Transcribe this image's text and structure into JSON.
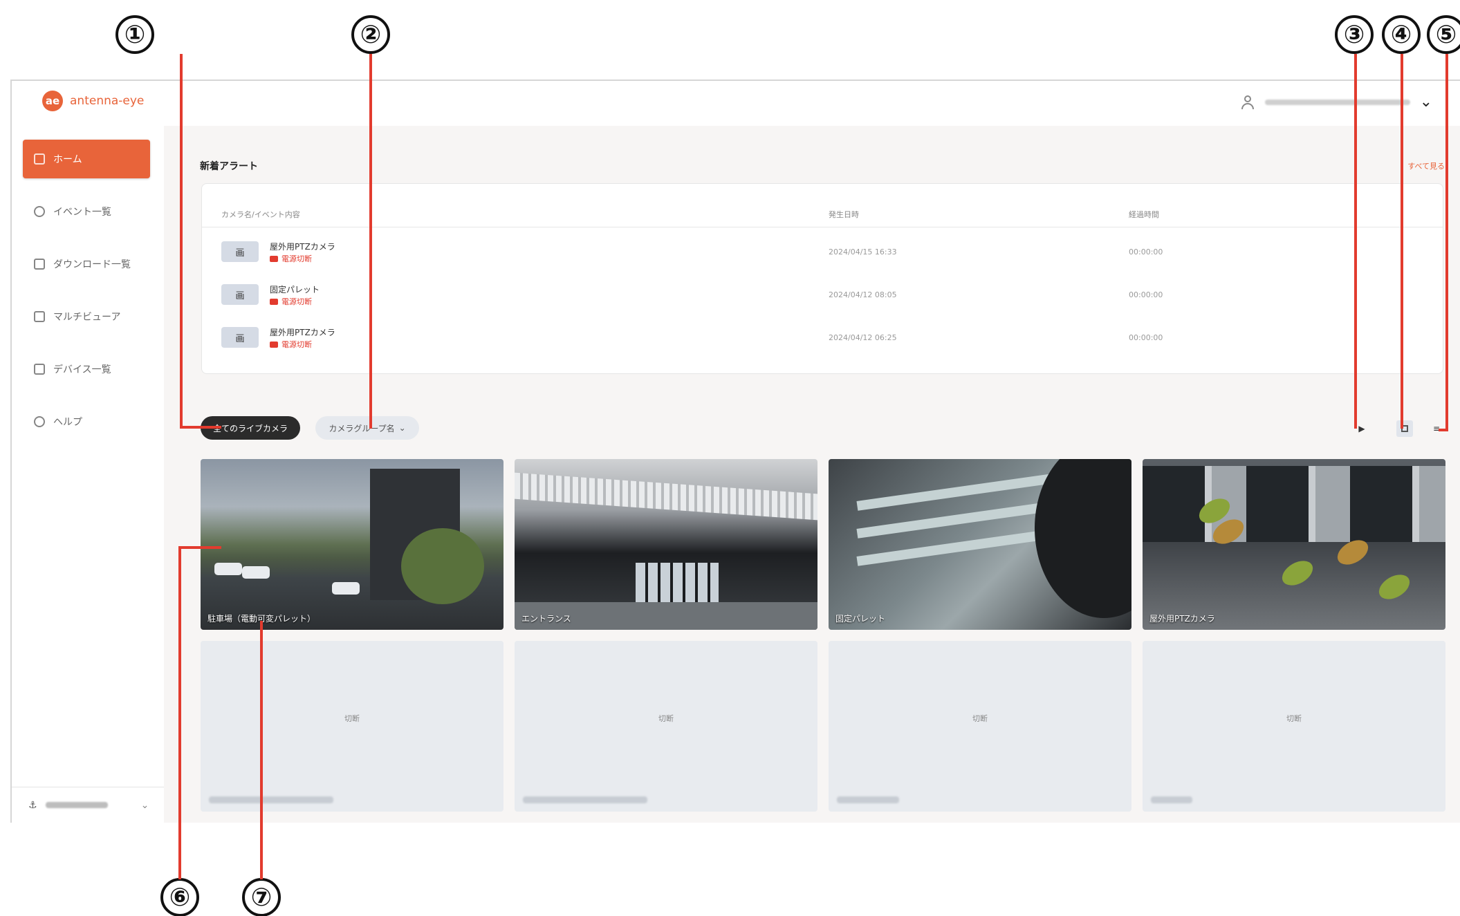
{
  "callouts": [
    "①",
    "②",
    "③",
    "④",
    "⑤",
    "⑥",
    "⑦"
  ],
  "brand": {
    "logo_mark": "ae",
    "name": "antenna-eye",
    "color": "#e8643a"
  },
  "header": {
    "user_icon": "user-icon",
    "chevron": "⌄"
  },
  "sidebar": {
    "items": [
      {
        "label": "ホーム",
        "icon": "home-icon",
        "active": true
      },
      {
        "label": "イベント一覧",
        "icon": "clock-icon",
        "active": false
      },
      {
        "label": "ダウンロード一覧",
        "icon": "download-icon",
        "active": false
      },
      {
        "label": "マルチビューア",
        "icon": "multiview-icon",
        "active": false
      },
      {
        "label": "デバイス一覧",
        "icon": "camera-icon",
        "active": false
      },
      {
        "label": "ヘルプ",
        "icon": "help-icon",
        "active": false
      }
    ],
    "org_icon": "⚓",
    "org_chevron": "⌄"
  },
  "alerts": {
    "title": "新着アラート",
    "see_all": "すべて見る",
    "columns": [
      "カメラ名/イベント内容",
      "発生日時",
      "経過時間"
    ],
    "rows": [
      {
        "thumb": "画",
        "camera": "屋外用PTZカメラ",
        "event": "電源切断",
        "datetime": "2024/04/15 16:33",
        "elapsed": "00:00:00"
      },
      {
        "thumb": "画",
        "camera": "固定パレット",
        "event": "電源切断",
        "datetime": "2024/04/12 08:05",
        "elapsed": "00:00:00"
      },
      {
        "thumb": "画",
        "camera": "屋外用PTZカメラ",
        "event": "電源切断",
        "datetime": "2024/04/12 06:25",
        "elapsed": "00:00:00"
      }
    ]
  },
  "filters": {
    "live_label": "全てのライブカメラ",
    "group_label": "カメラグループ名",
    "group_chevron": "⌄",
    "play": "▶",
    "list_view": "≡"
  },
  "cameras": [
    {
      "label": "駐車場（電動可変パレット）"
    },
    {
      "label": "エントランス"
    },
    {
      "label": "固定パレット"
    },
    {
      "label": "屋外用PTZカメラ"
    }
  ],
  "offline_tiles": [
    {
      "status": "切断"
    },
    {
      "status": "切断"
    },
    {
      "status": "切断"
    },
    {
      "status": "切断"
    }
  ],
  "colors": {
    "accent": "#e8643a",
    "callout_line": "#e23b2e",
    "alert_red": "#e23b2e"
  }
}
